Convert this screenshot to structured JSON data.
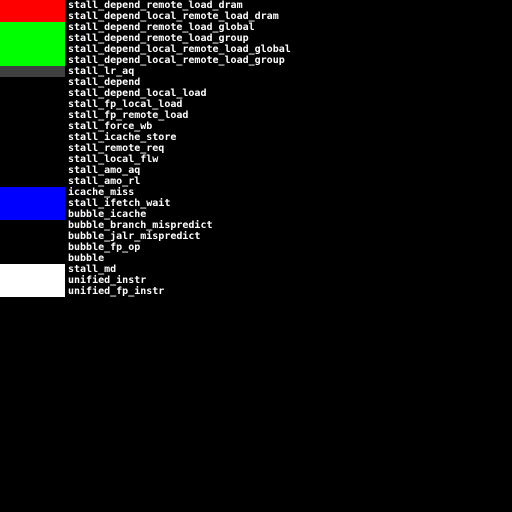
{
  "legend": {
    "items": [
      {
        "label": "stall_depend_remote_load_dram",
        "color": "#ff0000"
      },
      {
        "label": "stall_depend_local_remote_load_dram",
        "color": "#ff0000"
      },
      {
        "label": "stall_depend_remote_load_global",
        "color": "#00ff00"
      },
      {
        "label": "stall_depend_remote_load_group",
        "color": "#00ff00"
      },
      {
        "label": "stall_depend_local_remote_load_global",
        "color": "#00ff00"
      },
      {
        "label": "stall_depend_local_remote_load_group",
        "color": "#00ff00"
      },
      {
        "label": "stall_lr_aq",
        "color": "#404040"
      },
      {
        "label": "stall_depend",
        "color": "#000000"
      },
      {
        "label": "stall_depend_local_load",
        "color": "#000000"
      },
      {
        "label": "stall_fp_local_load",
        "color": "#000000"
      },
      {
        "label": "stall_fp_remote_load",
        "color": "#000000"
      },
      {
        "label": "stall_force_wb",
        "color": "#000000"
      },
      {
        "label": "stall_icache_store",
        "color": "#000000"
      },
      {
        "label": "stall_remote_req",
        "color": "#000000"
      },
      {
        "label": "stall_local_flw",
        "color": "#000000"
      },
      {
        "label": "stall_amo_aq",
        "color": "#000000"
      },
      {
        "label": "stall_amo_rl",
        "color": "#000000"
      },
      {
        "label": "icache_miss",
        "color": "#0000ff"
      },
      {
        "label": "stall_ifetch_wait",
        "color": "#0000ff"
      },
      {
        "label": "bubble_icache",
        "color": "#0000ff"
      },
      {
        "label": "bubble_branch_mispredict",
        "color": "#000000"
      },
      {
        "label": "bubble_jalr_mispredict",
        "color": "#000000"
      },
      {
        "label": "bubble_fp_op",
        "color": "#000000"
      },
      {
        "label": "bubble",
        "color": "#000000"
      },
      {
        "label": "stall_md",
        "color": "#ffffff"
      },
      {
        "label": "unified_instr",
        "color": "#ffffff"
      },
      {
        "label": "unified_fp_instr",
        "color": "#ffffff"
      }
    ]
  }
}
